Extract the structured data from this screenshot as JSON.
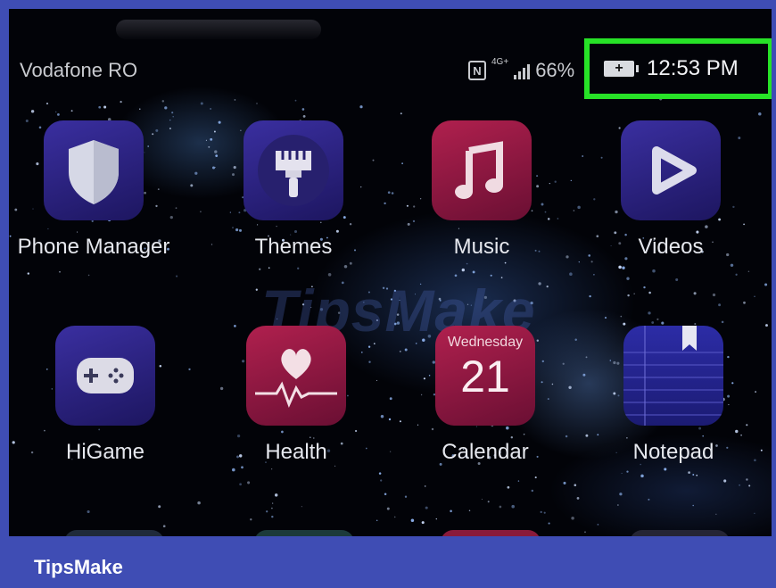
{
  "status_bar": {
    "carrier": "Vodafone RO",
    "nfc_icon": "nfc-icon",
    "network_label": "4G+",
    "battery_percent": "66%",
    "time": "12:53 PM"
  },
  "apps": [
    {
      "label": "Phone Manager",
      "icon": "shield-icon"
    },
    {
      "label": "Themes",
      "icon": "paintbrush-icon"
    },
    {
      "label": "Music",
      "icon": "music-note-icon"
    },
    {
      "label": "Videos",
      "icon": "play-icon"
    },
    {
      "label": "HiGame",
      "icon": "gamepad-icon"
    },
    {
      "label": "Health",
      "icon": "heart-pulse-icon"
    },
    {
      "label": "Calendar",
      "icon": "calendar-icon",
      "weekday": "Wednesday",
      "day": "21"
    },
    {
      "label": "Notepad",
      "icon": "notepad-icon"
    }
  ],
  "watermark": "TipsMake",
  "footer": {
    "brand": "TipsMake"
  },
  "colors": {
    "highlight": "#27e227",
    "frame": "#3f4db4"
  }
}
